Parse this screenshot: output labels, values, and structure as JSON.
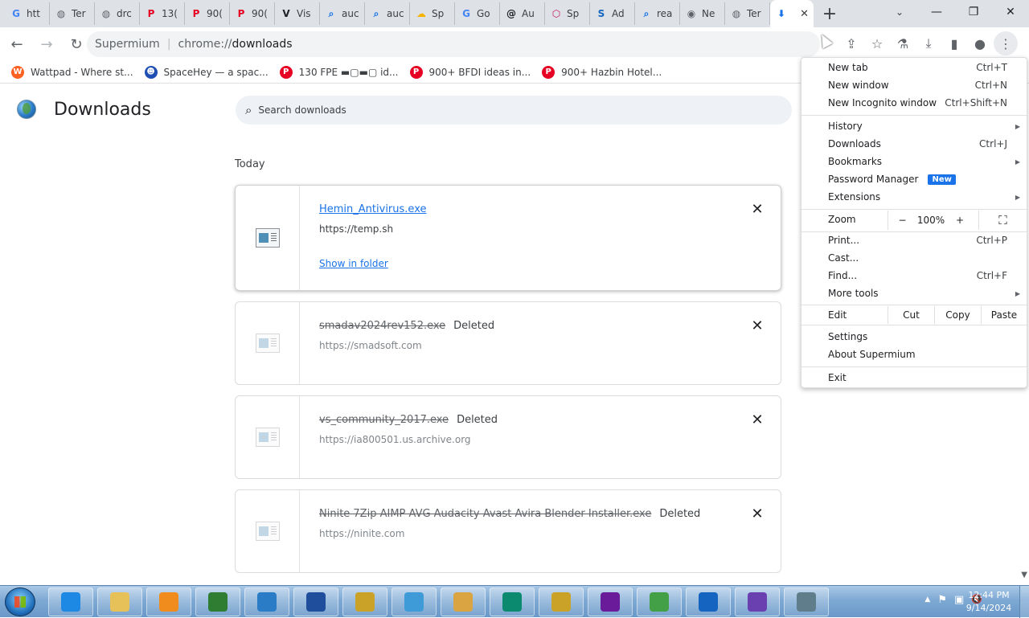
{
  "tabs": [
    {
      "label": "htt",
      "icon": "google-icon",
      "color": "#4285f4",
      "glyph": "G"
    },
    {
      "label": "Ter",
      "icon": "globe-icon",
      "color": "#5f6368",
      "glyph": "◍"
    },
    {
      "label": "drc",
      "icon": "globe-icon",
      "color": "#5f6368",
      "glyph": "◍"
    },
    {
      "label": "13(",
      "icon": "pinterest-icon",
      "color": "#e60023",
      "glyph": "P"
    },
    {
      "label": "90(",
      "icon": "pinterest-icon",
      "color": "#e60023",
      "glyph": "P"
    },
    {
      "label": "90(",
      "icon": "pinterest-icon",
      "color": "#e60023",
      "glyph": "P"
    },
    {
      "label": "Vis",
      "icon": "vinted-icon",
      "color": "#202124",
      "glyph": "V"
    },
    {
      "label": "auc",
      "icon": "search-icon",
      "color": "#1a73e8",
      "glyph": "⌕"
    },
    {
      "label": "auc",
      "icon": "search-icon",
      "color": "#1a73e8",
      "glyph": "⌕"
    },
    {
      "label": "Sp",
      "icon": "cloud-icon",
      "color": "#f4b400",
      "glyph": "☁"
    },
    {
      "label": "Go",
      "icon": "google-icon",
      "color": "#4285f4",
      "glyph": "G"
    },
    {
      "label": "Au",
      "icon": "at-icon",
      "color": "#202124",
      "glyph": "@"
    },
    {
      "label": "Sp",
      "icon": "cube-icon",
      "color": "#c2185b",
      "glyph": "⬡"
    },
    {
      "label": "Ad",
      "icon": "s-icon",
      "color": "#1565c0",
      "glyph": "S"
    },
    {
      "label": "rea",
      "icon": "search-icon",
      "color": "#1a73e8",
      "glyph": "⌕"
    },
    {
      "label": "Ne",
      "icon": "chrome-icon",
      "color": "#5f6368",
      "glyph": "◉"
    },
    {
      "label": "Ter",
      "icon": "globe-icon",
      "color": "#5f6368",
      "glyph": "◍"
    }
  ],
  "active_tab": {
    "icon": "download-icon",
    "glyph": "⬇",
    "close": "✕"
  },
  "new_tab_glyph": "+",
  "window_controls": {
    "minimize": "—",
    "maximize": "❐",
    "close": "✕",
    "tab_search": "⌄"
  },
  "toolbar": {
    "back": "←",
    "forward": "→",
    "reload": "↻",
    "origin": "Supermium",
    "url_scheme": "chrome://",
    "url_path": "downloads",
    "icons": {
      "share": "⇪",
      "star": "☆",
      "extensions": "⚗",
      "downloads": "⤓",
      "sidepanel": "▮",
      "profile": "●",
      "menu": "⋮"
    }
  },
  "bookmarks": [
    {
      "label": "Wattpad - Where st...",
      "icon": "wattpad-icon",
      "color": "#ff6122",
      "glyph": "W"
    },
    {
      "label": "SpaceHey — a spac...",
      "icon": "spacehey-icon",
      "color": "#1f4fb3",
      "glyph": "☻"
    },
    {
      "label": "130 FPE ▬▢▬▢ id...",
      "icon": "pinterest-icon",
      "color": "#e60023",
      "glyph": "P"
    },
    {
      "label": "900+ BFDI ideas in...",
      "icon": "pinterest-icon",
      "color": "#e60023",
      "glyph": "P"
    },
    {
      "label": "900+ Hazbin Hotel...",
      "icon": "pinterest-icon",
      "color": "#e60023",
      "glyph": "P"
    }
  ],
  "page": {
    "title": "Downloads",
    "search_placeholder": "Search downloads",
    "section": "Today"
  },
  "downloads": [
    {
      "filename": "Hemin_Antivirus.exe",
      "status": "",
      "url": "https://temp.sh",
      "action": "Show in folder",
      "deleted": false
    },
    {
      "filename": "smadav2024rev152.exe",
      "status": "Deleted",
      "url": "https://smadsoft.com",
      "action": "",
      "deleted": true
    },
    {
      "filename": "vs_community_2017.exe",
      "status": "Deleted",
      "url": "https://ia800501.us.archive.org",
      "action": "",
      "deleted": true
    },
    {
      "filename": "Ninite 7Zip AIMP AVG Audacity Avast Avira Blender Installer.exe",
      "status": "Deleted",
      "url": "https://ninite.com",
      "action": "",
      "deleted": true
    }
  ],
  "menu": {
    "new_tab": {
      "label": "New tab",
      "shortcut": "Ctrl+T"
    },
    "new_window": {
      "label": "New window",
      "shortcut": "Ctrl+N"
    },
    "new_incognito": {
      "label": "New Incognito window",
      "shortcut": "Ctrl+Shift+N"
    },
    "history": {
      "label": "History"
    },
    "downloads": {
      "label": "Downloads",
      "shortcut": "Ctrl+J"
    },
    "bookmarks": {
      "label": "Bookmarks"
    },
    "password_manager": {
      "label": "Password Manager",
      "badge": "New"
    },
    "extensions": {
      "label": "Extensions"
    },
    "zoom": {
      "label": "Zoom",
      "minus": "−",
      "level": "100%",
      "plus": "+",
      "fullscreen": "⛶"
    },
    "print": {
      "label": "Print...",
      "shortcut": "Ctrl+P"
    },
    "cast": {
      "label": "Cast..."
    },
    "find": {
      "label": "Find...",
      "shortcut": "Ctrl+F"
    },
    "more_tools": {
      "label": "More tools"
    },
    "edit": {
      "label": "Edit",
      "cut": "Cut",
      "copy": "Copy",
      "paste": "Paste"
    },
    "settings": {
      "label": "Settings"
    },
    "about": {
      "label": "About Supermium"
    },
    "exit": {
      "label": "Exit"
    },
    "submenu_arrow": "▶"
  },
  "taskbar": {
    "apps": [
      {
        "name": "internet-explorer-icon",
        "color": "#1e88e5"
      },
      {
        "name": "file-explorer-icon",
        "color": "#e6c15a"
      },
      {
        "name": "media-player-icon",
        "color": "#f08c1e"
      },
      {
        "name": "terminal-icon",
        "color": "#2e7d32"
      },
      {
        "name": "supermium-icon",
        "color": "#2a7cc7"
      },
      {
        "name": "office-icon",
        "color": "#1f4f9c"
      },
      {
        "name": "wand-icon",
        "color": "#c9a227"
      },
      {
        "name": "network-users-icon",
        "color": "#3f9bd8"
      },
      {
        "name": "paint-icon",
        "color": "#d9a441"
      },
      {
        "name": "edge-icon",
        "color": "#0c8a6f"
      },
      {
        "name": "wand-icon-2",
        "color": "#c9a227"
      },
      {
        "name": "yahoo-messenger-icon",
        "color": "#6a1b9a"
      },
      {
        "name": "bluestacks-icon",
        "color": "#43a047"
      },
      {
        "name": "shark-icon",
        "color": "#1565c0"
      },
      {
        "name": "visual-studio-icon",
        "color": "#6a3fb0"
      },
      {
        "name": "computer-icon",
        "color": "#607d8b"
      }
    ],
    "tray": {
      "chevron": "▲",
      "flag": "⚑",
      "network": "▣",
      "volume": "🔇"
    },
    "time": "12:44 PM",
    "date": "9/14/2024"
  }
}
